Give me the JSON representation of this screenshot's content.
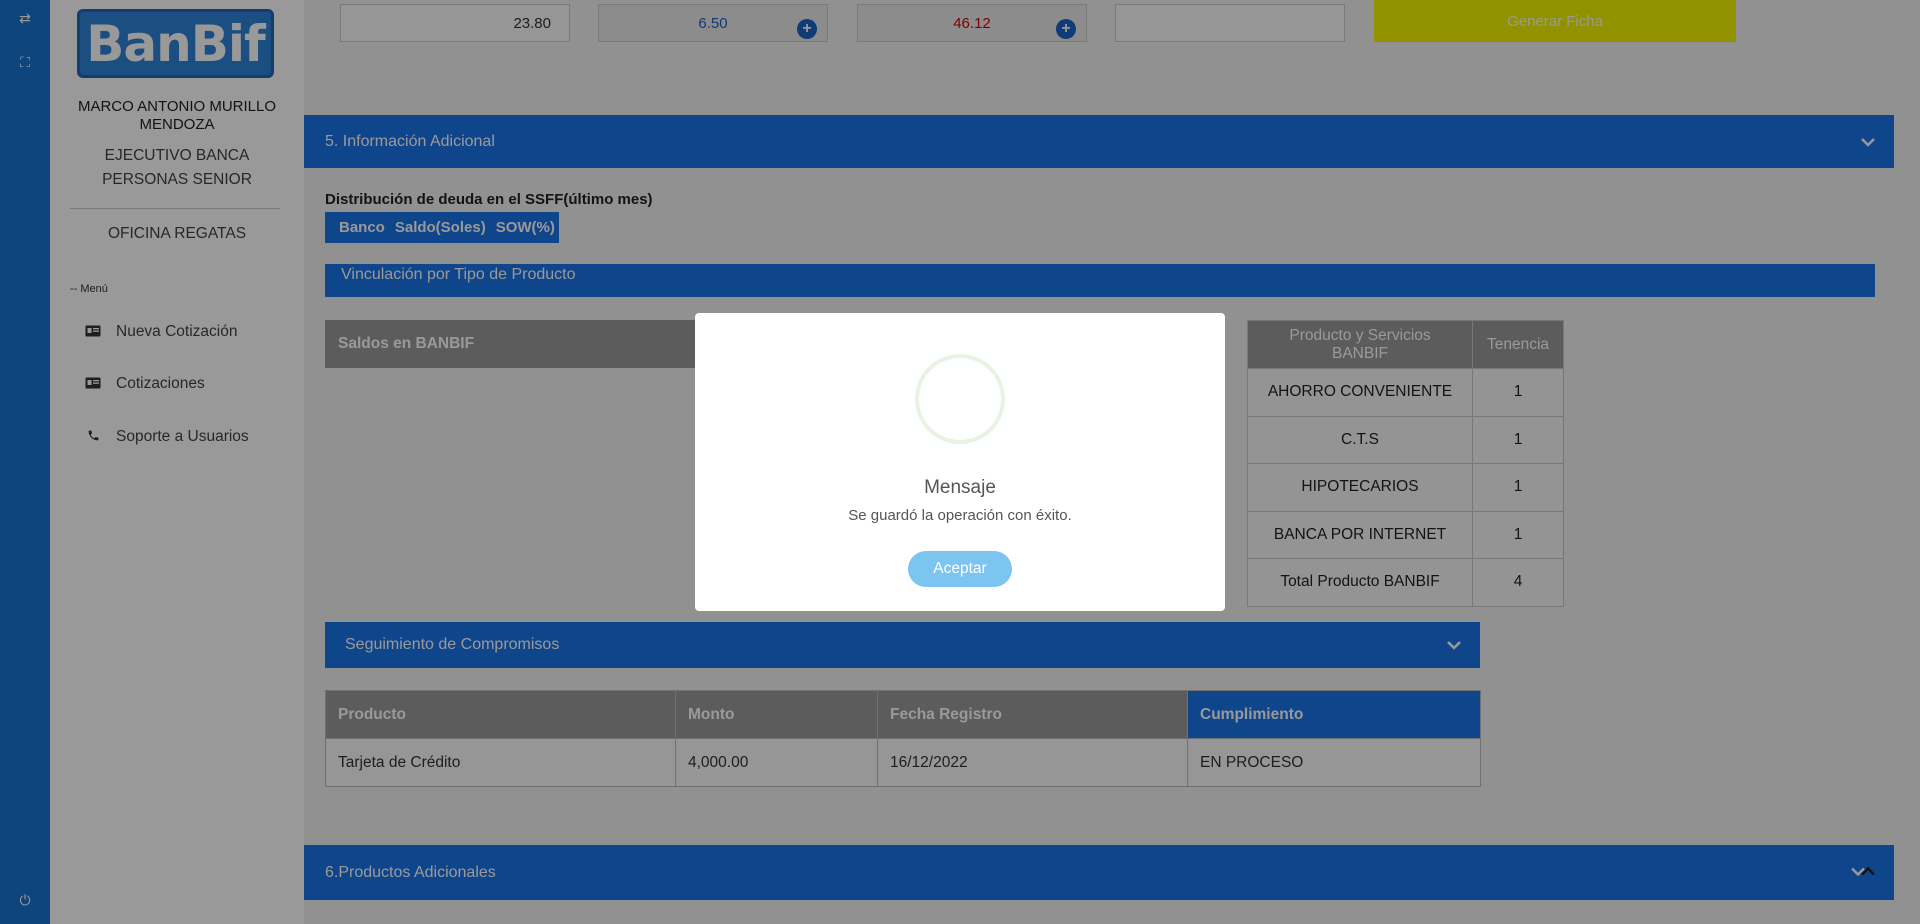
{
  "iconbar": {
    "top_icon": "⇄",
    "expand_icon": "⛶",
    "power_icon": "⏻"
  },
  "sidebar": {
    "logo_text": "BanBif",
    "user_name": "MARCO ANTONIO MURILLO MENDOZA",
    "user_role": "EJECUTIVO BANCA PERSONAS SENIOR",
    "office": "OFICINA REGATAS",
    "menu_label": "-- Menú",
    "items": [
      {
        "label": "Nueva Cotización",
        "icon": "id-card-icon"
      },
      {
        "label": "Cotizaciones",
        "icon": "id-card-icon"
      },
      {
        "label": "Soporte a Usuarios",
        "icon": "phone-icon"
      }
    ]
  },
  "top_inputs": {
    "field1": "23.80",
    "field2": "6.50",
    "field3": "46.12",
    "field4": "",
    "generate_button": "Generar Ficha"
  },
  "section5": {
    "title": "5. Información Adicional",
    "dist_title": "Distribución de deuda en el SSFF(último mes)",
    "dist_cols": [
      "Banco",
      "Saldo(Soles)",
      "SOW(%)"
    ],
    "vinculacion_title": "Vinculación por Tipo de Producto",
    "saldos_title": "Saldos en BANBIF",
    "products_table": {
      "headers": [
        "Producto y Servicios BANBIF",
        "Tenencia"
      ],
      "rows": [
        [
          "AHORRO CONVENIENTE",
          "1"
        ],
        [
          "C.T.S",
          "1"
        ],
        [
          "HIPOTECARIOS",
          "1"
        ],
        [
          "BANCA POR INTERNET",
          "1"
        ],
        [
          "Total Producto BANBIF",
          "4"
        ]
      ]
    },
    "seguimiento_title": "Seguimiento de Compromisos",
    "seguimiento_table": {
      "headers": [
        "Producto",
        "Monto",
        "Fecha Registro",
        "Cumplimiento"
      ],
      "rows": [
        [
          "Tarjeta de Crédito",
          "4,000.00",
          "16/12/2022",
          "EN PROCESO"
        ]
      ]
    }
  },
  "section6": {
    "title": "6.Productos Adicionales"
  },
  "modal": {
    "title": "Mensaje",
    "message": "Se guardó la operación con éxito.",
    "button": "Aceptar"
  },
  "colors": {
    "primary_blue": "#1a73e8",
    "generate_yellow": "#f3f300",
    "field2_value": "#1a63c6",
    "field3_value": "#d40000",
    "modal_button": "#7dc5f1"
  }
}
